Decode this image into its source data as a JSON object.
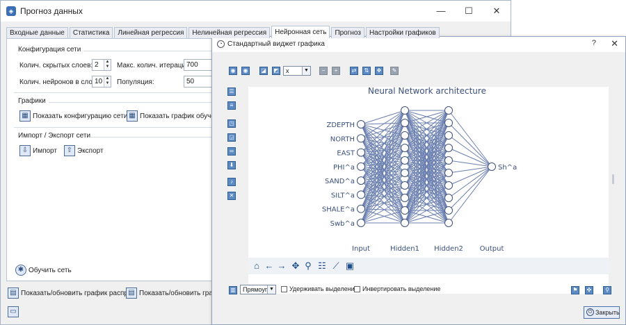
{
  "main_window": {
    "title": "Прогноз данных",
    "controls": {
      "minimize": "—",
      "maximize": "☐",
      "close": "✕"
    },
    "tabs": [
      {
        "label": "Входные данные",
        "active": false
      },
      {
        "label": "Статистика",
        "active": false
      },
      {
        "label": "Линейная регрессия",
        "active": false
      },
      {
        "label": "Нелинейная регрессия",
        "active": false
      },
      {
        "label": "Нейронная сеть",
        "active": true
      },
      {
        "label": "Прогноз",
        "active": false
      },
      {
        "label": "Настройки графиков",
        "active": false
      }
    ],
    "config": {
      "title": "Конфигурация сети",
      "hidden_layers_label": "Колич. скрытых слоев:",
      "hidden_layers_value": "2",
      "neurons_label": "Колич. нейронов в слое:",
      "neurons_value": "10",
      "max_iter_label": "Макс. колич. итераций:",
      "max_iter_value": "700",
      "population_label": "Популяция:",
      "population_value": "50"
    },
    "graphs": {
      "title": "Графики",
      "show_config": "Показать конфигурацию сети",
      "show_training": "Показать график обучения"
    },
    "import_export": {
      "title": "Импорт / Экспорт сети",
      "import": "Импорт",
      "export": "Экспорт"
    },
    "train_button": "Обучить сеть",
    "footer_buttons": {
      "show_update_distr": "Показать/обновить график распр.",
      "show_update_other": "Показать/обновить графи"
    }
  },
  "chart_widget": {
    "title": "Стандартный виджет графика",
    "help": "?",
    "close": "✕",
    "axis_select": "x",
    "plot_type_select": "Прямоуг.",
    "keep_selection": "Удерживать выделение",
    "invert_selection": "Инвертировать выделение",
    "close_button": "Закрыть",
    "nav_icons": [
      "home-icon",
      "back-arrow-icon",
      "forward-arrow-icon",
      "pan-icon",
      "zoom-icon",
      "configure-subplots-icon",
      "edit-axis-icon",
      "save-icon"
    ]
  },
  "chart_data": {
    "type": "diagram",
    "title": "Neural Network architecture",
    "layers": [
      {
        "name": "Input",
        "size": 8,
        "labels": [
          "ZDEPTH",
          "NORTH",
          "EAST",
          "PHI^a",
          "SAND^a",
          "SILT^a",
          "SHALE^a",
          "Swb^a"
        ]
      },
      {
        "name": "Hidden1",
        "size": 10
      },
      {
        "name": "Hidden2",
        "size": 10
      },
      {
        "name": "Output",
        "size": 1,
        "labels": [
          "Sh^a"
        ]
      }
    ],
    "connections": "fully-connected between consecutive layers",
    "color": "#6a7fb0"
  }
}
